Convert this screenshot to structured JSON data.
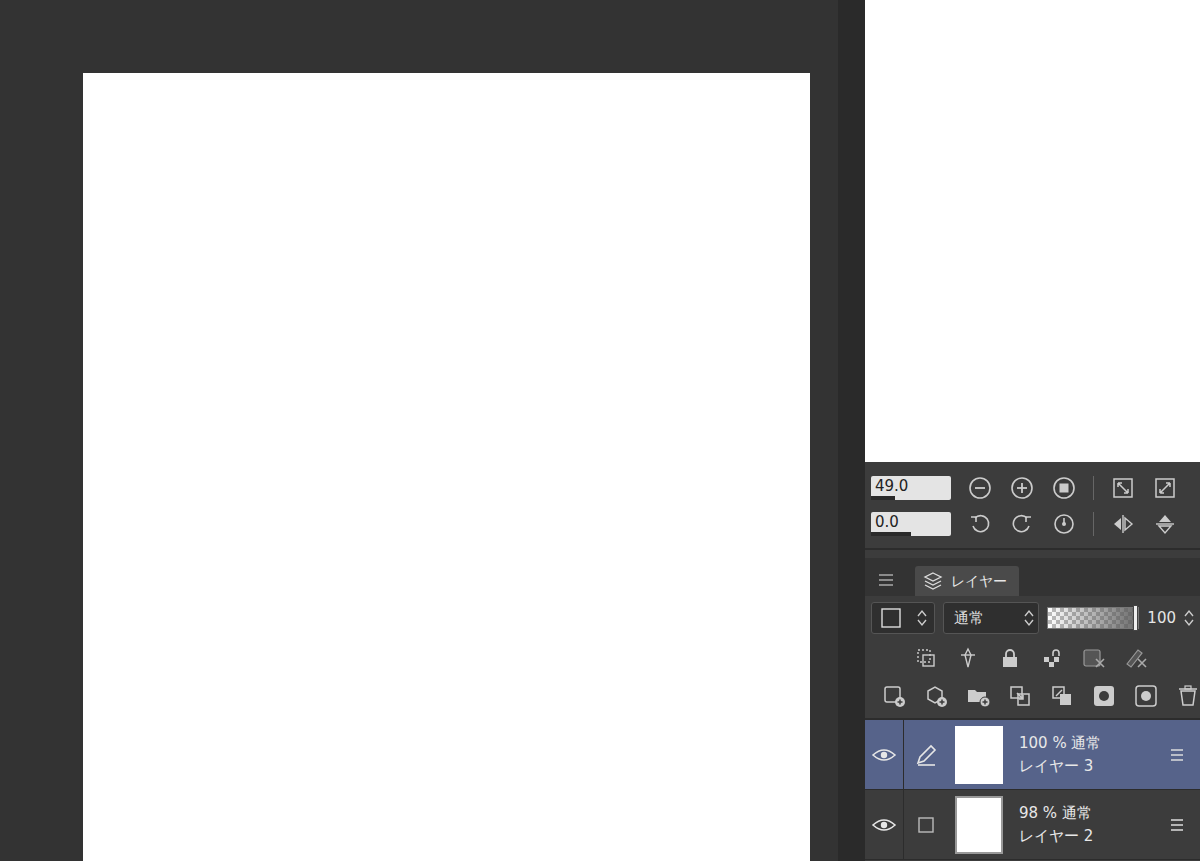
{
  "navigator": {
    "zoom": {
      "reading": "49.0",
      "level": 0.3
    },
    "rotation": {
      "reading": "0.0",
      "level": 0.5
    }
  },
  "layer_palette": {
    "tab": "レイヤー",
    "blend_mode": "通常",
    "opacity": {
      "reading": "100",
      "level": 1
    }
  },
  "layers": [
    {
      "opacity": "100 %",
      "blend": "通常",
      "name": "レイヤー 3",
      "visible": true,
      "editing": true,
      "selected": true
    },
    {
      "opacity": "98 %",
      "blend": "通常",
      "name": "レイヤー 2",
      "visible": true,
      "editing": false,
      "selected": false
    }
  ]
}
